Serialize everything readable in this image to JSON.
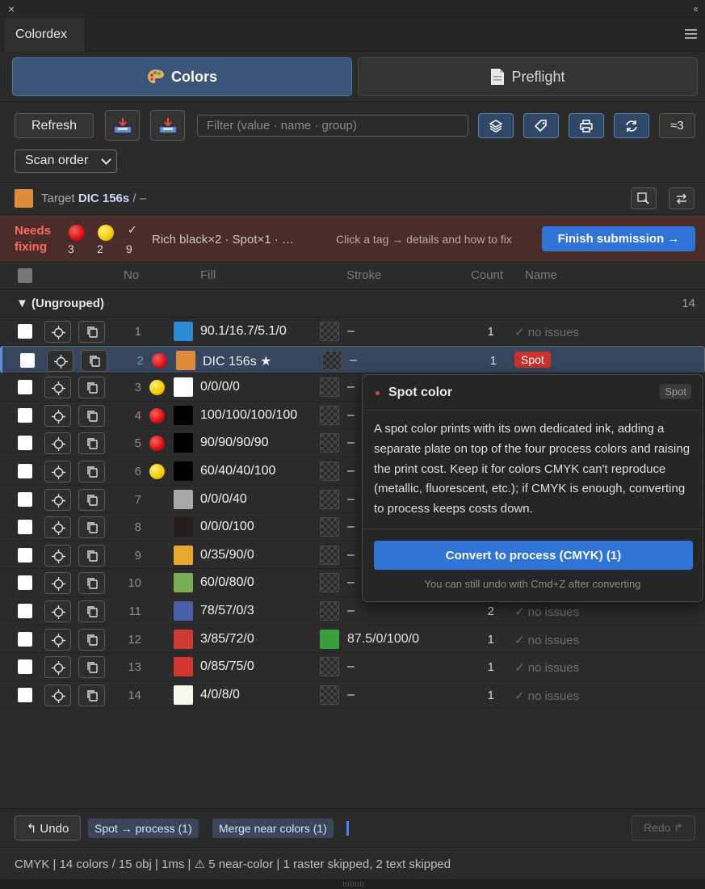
{
  "window": {
    "close": "×",
    "collapse": "‹‹"
  },
  "panel": {
    "tab": "Colordex"
  },
  "modes": {
    "colors": "Colors",
    "preflight": "Preflight"
  },
  "toolbar": {
    "refresh": "Refresh",
    "filter_placeholder": "Filter (value · name · group)",
    "near": "≈3",
    "scan_order": "Scan order"
  },
  "target": {
    "label": "Target",
    "value": "DIC 156s",
    "suffix": "/ –",
    "color": "#e08a3c"
  },
  "needs": {
    "title_line1": "Needs",
    "title_line2": "fixing",
    "red_count": "3",
    "yellow_count": "2",
    "ok_mark": "✓",
    "ok_count": "9",
    "summary": "Rich black×2 · Spot×1 · …",
    "hint": "Click a tag → details and how to fix",
    "finish": "Finish submission →"
  },
  "columns": {
    "no": "No",
    "fill": "Fill",
    "stroke": "Stroke",
    "count": "Count",
    "name": "Name"
  },
  "group": {
    "name": "▼ (Ungrouped)",
    "count": "14"
  },
  "rows": [
    {
      "no": "1",
      "dot": "",
      "fill_color": "#2a8ad6",
      "fill": "90.1/16.7/5.1/0",
      "stroke_color": "",
      "stroke": "–",
      "count": "1",
      "name": "✓ no issues",
      "badge": ""
    },
    {
      "no": "2",
      "dot": "red",
      "fill_color": "#e08a3c",
      "fill": "DIC 156s ★",
      "stroke_color": "",
      "stroke": "–",
      "count": "1",
      "name": "",
      "badge": "Spot"
    },
    {
      "no": "3",
      "dot": "yellow",
      "fill_color": "#ffffff",
      "fill": "0/0/0/0",
      "stroke_color": "",
      "stroke": "–",
      "count": "",
      "name": "",
      "badge": ""
    },
    {
      "no": "4",
      "dot": "red",
      "fill_color": "#000000",
      "fill": "100/100/100/100",
      "stroke_color": "",
      "stroke": "–",
      "count": "",
      "name": "",
      "badge": ""
    },
    {
      "no": "5",
      "dot": "red",
      "fill_color": "#000000",
      "fill": "90/90/90/90",
      "stroke_color": "",
      "stroke": "–",
      "count": "",
      "name": "",
      "badge": ""
    },
    {
      "no": "6",
      "dot": "yellow",
      "fill_color": "#000000",
      "fill": "60/40/40/100",
      "stroke_color": "",
      "stroke": "–",
      "count": "",
      "name": "",
      "badge": ""
    },
    {
      "no": "7",
      "dot": "",
      "fill_color": "#a8a8a8",
      "fill": "0/0/0/40",
      "stroke_color": "",
      "stroke": "–",
      "count": "",
      "name": "",
      "badge": ""
    },
    {
      "no": "8",
      "dot": "",
      "fill_color": "#231e1c",
      "fill": "0/0/0/100",
      "stroke_color": "",
      "stroke": "–",
      "count": "",
      "name": "",
      "badge": ""
    },
    {
      "no": "9",
      "dot": "",
      "fill_color": "#e6a72c",
      "fill": "0/35/90/0",
      "stroke_color": "",
      "stroke": "–",
      "count": "",
      "name": "",
      "badge": ""
    },
    {
      "no": "10",
      "dot": "",
      "fill_color": "#79ad52",
      "fill": "60/0/80/0",
      "stroke_color": "",
      "stroke": "–",
      "count": "",
      "name": "",
      "badge": ""
    },
    {
      "no": "11",
      "dot": "",
      "fill_color": "#4a5fa6",
      "fill": "78/57/0/3",
      "stroke_color": "",
      "stroke": "–",
      "count": "2",
      "name": "✓ no issues",
      "badge": ""
    },
    {
      "no": "12",
      "dot": "",
      "fill_color": "#cf3b34",
      "fill": "3/85/72/0",
      "stroke_color": "#3a9e3a",
      "stroke": "87.5/0/100/0",
      "count": "1",
      "name": "✓ no issues",
      "badge": ""
    },
    {
      "no": "13",
      "dot": "",
      "fill_color": "#d3362f",
      "fill": "0/85/75/0",
      "stroke_color": "",
      "stroke": "–",
      "count": "1",
      "name": "✓ no issues",
      "badge": ""
    },
    {
      "no": "14",
      "dot": "",
      "fill_color": "#f8f8ee",
      "fill": "4/0/8/0",
      "stroke_color": "",
      "stroke": "–",
      "count": "1",
      "name": "✓ no issues",
      "badge": ""
    }
  ],
  "popover": {
    "title": "Spot color",
    "tag": "Spot",
    "body": "A spot color prints with its own dedicated ink, adding a separate plate on top of the four process colors and raising the print cost. Keep it for colors CMYK can't reproduce (metallic, fluorescent, etc.); if CMYK is enough, converting to process keeps costs down.",
    "convert": "Convert to process (CMYK) (1)",
    "note": "You can still undo with Cmd+Z after converting"
  },
  "history": {
    "undo": "↰ Undo",
    "chip1": "Spot → process (1)",
    "chip2": "Merge near colors (1)",
    "redo": "Redo ↱"
  },
  "status": "CMYK | 14 colors / 15 obj | 1ms | ⚠ 5 near-color | 1 raster skipped, 2 text skipped"
}
